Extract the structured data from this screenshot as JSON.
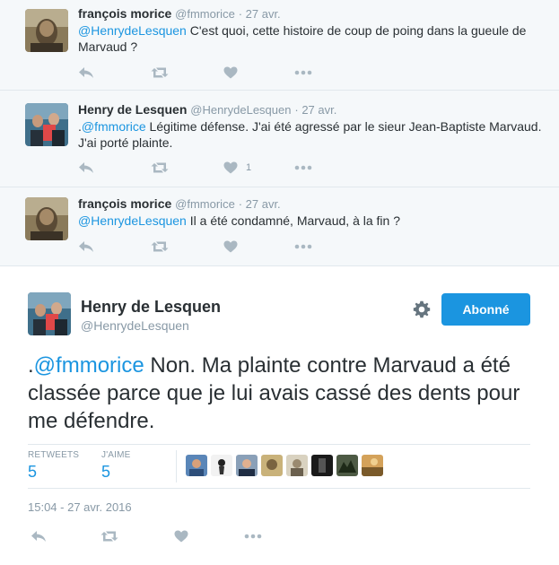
{
  "replies": [
    {
      "name": "françois morice",
      "handle": "@fmmorice",
      "date": "· 27 avr.",
      "mention": "@HenrydeLesquen",
      "text": " C'est quoi, cette histoire de coup de poing dans la gueule de Marvaud ?",
      "likes": ""
    },
    {
      "name": "Henry de Lesquen",
      "handle": "@HenrydeLesquen",
      "date": "· 27 avr.",
      "prefix": ".",
      "mention": "@fmmorice",
      "text": " Légitime défense. J'ai été agressé par le sieur Jean-Baptiste Marvaud. J'ai porté plainte.",
      "likes": "1"
    },
    {
      "name": "françois morice",
      "handle": "@fmmorice",
      "date": "· 27 avr.",
      "mention": "@HenrydeLesquen",
      "text": " Il a été condamné, Marvaud, à la fin ?",
      "likes": ""
    }
  ],
  "main": {
    "name": "Henry de Lesquen",
    "handle": "@HenrydeLesquen",
    "follow_label": "Abonné",
    "prefix": ".",
    "mention": "@fmmorice",
    "text": " Non. Ma plainte contre Marvaud a été classée parce que je lui avais cassé des dents pour me défendre.",
    "retweets_label": "RETWEETS",
    "retweets": "5",
    "likes_label": "J'AIME",
    "likes": "5",
    "timestamp": "15:04 - 27 avr. 2016"
  },
  "colors": {
    "accent": "#1b95e0",
    "muted": "#8899a6",
    "text": "#292f33",
    "reply_bg": "#f5f8fa"
  },
  "icons": [
    "reply-icon",
    "retweet-icon",
    "like-icon",
    "more-icon",
    "gear-icon"
  ]
}
